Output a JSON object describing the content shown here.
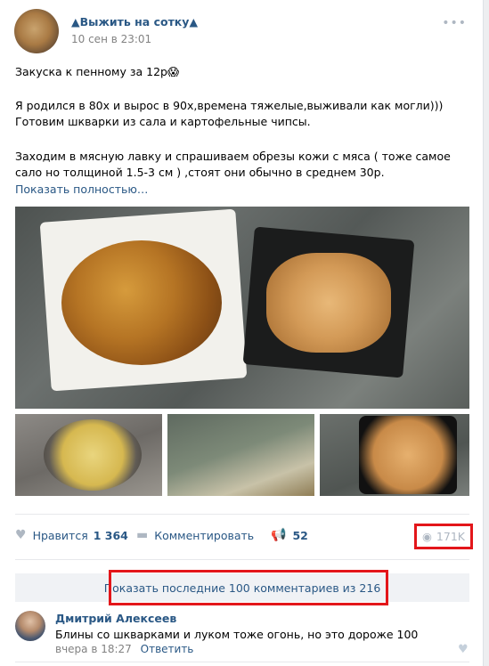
{
  "post": {
    "author": "▲Выжить на сотку▲",
    "date": "10 сен в 23:01",
    "more_icon": "more-horizontal-icon",
    "text_line1": "Закуска к пенному за 12р😱",
    "text_para2": "Я родился в 80х и вырос в 90х,времена тяжелые,выживали как могли))) Готовим шкварки из сала и картофельные чипсы.",
    "text_para3": "Заходим в мясную лавку и спрашиваем обрезы кожи с мяса ( тоже самое сало но толщиной 1.5-3 см ) ,стоят они обычно в среднем 30р.",
    "show_more": "Показать полностью…"
  },
  "actions": {
    "like_label": "Нравится",
    "like_count": "1 364",
    "comment_label": "Комментировать",
    "share_count": "52",
    "views": "171K"
  },
  "comments": {
    "show_all": "Показать последние 100 комментариев из 216",
    "first": {
      "author": "Дмитрий Алексеев",
      "text": "Блины со шкварками и луком тоже огонь, но это дороже 100",
      "time": "вчера в 18:27",
      "reply": "Ответить"
    }
  },
  "colors": {
    "link": "#2a5885",
    "highlight": "#e3161a",
    "muted": "#828282"
  }
}
